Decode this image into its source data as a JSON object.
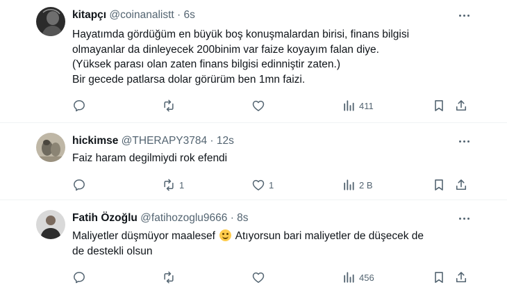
{
  "tweets": [
    {
      "name": "kitapçı",
      "handle": "@coinanalistt",
      "sep": "·",
      "time": "6s",
      "avatar_icon": "dark-profile-avatar",
      "lines": [
        "Hayatımda gördüğüm en büyük boş konuşmalardan birisi, finans bilgisi",
        "olmayanlar da dinleyecek 200binim var faize koyayım falan diye.",
        "(Yüksek parası olan zaten finans bilgisi edinniştir zaten.)",
        "Bir gecede patlarsa dolar görürüm ben 1mn faizi."
      ],
      "replies": "",
      "retweets": "",
      "likes": "",
      "views": "411"
    },
    {
      "name": "hickimse",
      "handle": "@THERAPY3784",
      "sep": "·",
      "time": "12s",
      "avatar_icon": "animal-photo-avatar",
      "lines": [
        "Faiz haram degilmiydi rok efendi"
      ],
      "replies": "",
      "retweets": "1",
      "likes": "1",
      "views": "2 B"
    },
    {
      "name": "Fatih Özoğlu",
      "handle": "@fatihozoglu9666",
      "sep": "·",
      "time": "8s",
      "avatar_icon": "person-photo-avatar",
      "line1_before_emoji": "Maliyetler düşmüyor maalesef ",
      "emoji": "smiling-face-emoji",
      "line1_after_emoji": " Atıyorsun bari maliyetler de düşecek de",
      "line2": "de destekli olsun",
      "replies": "",
      "retweets": "",
      "likes": "",
      "views": "456"
    }
  ],
  "icons": {
    "reply": "reply-icon",
    "retweet": "retweet-icon",
    "like": "heart-icon",
    "views": "views-bar-chart-icon",
    "bookmark": "bookmark-icon",
    "share": "share-icon",
    "more": "more-dots-icon"
  },
  "colors": {
    "text": "#0f1419",
    "secondary": "#536471",
    "divider": "#eff3f4",
    "emoji": "#ffcc4d"
  }
}
